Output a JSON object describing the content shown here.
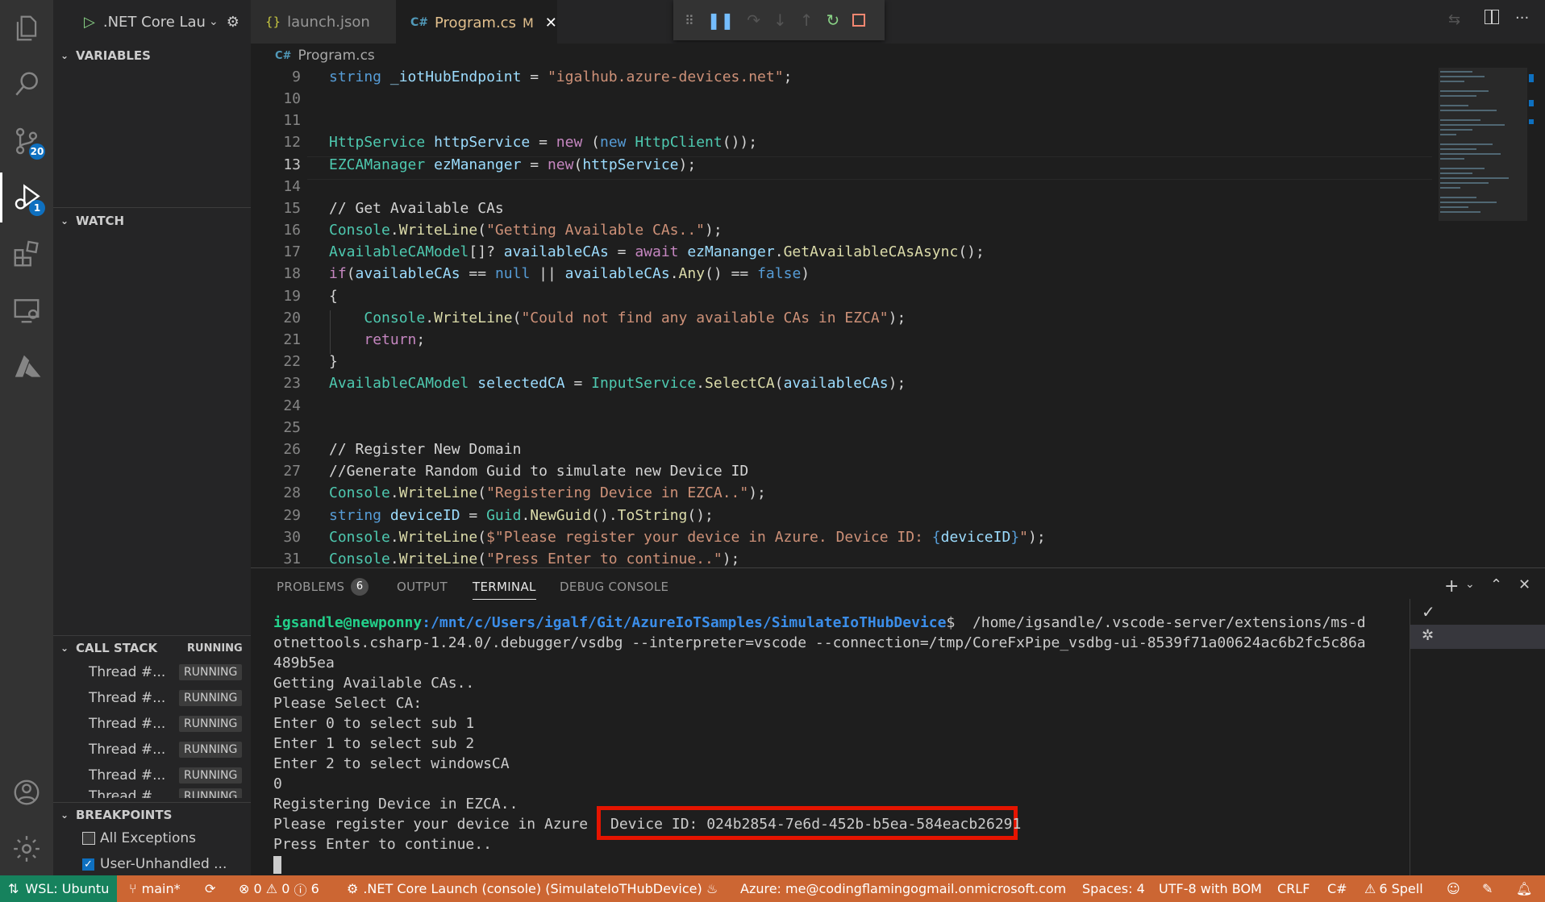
{
  "activity": {
    "scm_badge": "20",
    "debug_badge": "1"
  },
  "debug_toolbar": {
    "config_label": ".NET Core Lau"
  },
  "sidebar": {
    "variables_title": "VARIABLES",
    "watch_title": "WATCH",
    "call_stack_title": "CALL STACK",
    "call_stack_status": "RUNNING",
    "threads": [
      {
        "name": "Thread #...",
        "status": "RUNNING"
      },
      {
        "name": "Thread #...",
        "status": "RUNNING"
      },
      {
        "name": "Thread #...",
        "status": "RUNNING"
      },
      {
        "name": "Thread #...",
        "status": "RUNNING"
      },
      {
        "name": "Thread #...",
        "status": "RUNNING"
      },
      {
        "name": "Thread #...",
        "status": "RUNNING"
      }
    ],
    "breakpoints_title": "BREAKPOINTS",
    "breakpoints": [
      {
        "label": "All Exceptions",
        "checked": false
      },
      {
        "label": "User-Unhandled ...",
        "checked": true
      }
    ]
  },
  "tabs": [
    {
      "label": "launch.json",
      "icon": "{}"
    },
    {
      "label": "Program.cs",
      "modified": "M",
      "icon": "C#"
    }
  ],
  "breadcrumb": "Program.cs",
  "code": {
    "lines": [
      {
        "n": "9",
        "t": "string _iotHubEndpoint = \"igalhub.azure-devices.net\";"
      },
      {
        "n": "10",
        "t": ""
      },
      {
        "n": "11",
        "t": ""
      },
      {
        "n": "12",
        "t": "HttpService httpService = new (new HttpClient());"
      },
      {
        "n": "13",
        "t": "EZCAManager ezManager = new(httpService);"
      },
      {
        "n": "14",
        "t": ""
      },
      {
        "n": "15",
        "t": "// Get Available CAs"
      },
      {
        "n": "16",
        "t": "Console.WriteLine(\"Getting Available CAs..\");"
      },
      {
        "n": "17",
        "t": "AvailableCAModel[]? availableCAs = await ezManager.GetAvailableCAsAsync();"
      },
      {
        "n": "18",
        "t": "if(availableCAs == null || availableCAs.Any() == false)"
      },
      {
        "n": "19",
        "t": "{"
      },
      {
        "n": "20",
        "t": "    Console.WriteLine(\"Could not find any available CAs in EZCA\");"
      },
      {
        "n": "21",
        "t": "    return;"
      },
      {
        "n": "22",
        "t": "}"
      },
      {
        "n": "23",
        "t": "AvailableCAModel selectedCA = InputService.SelectCA(availableCAs);"
      },
      {
        "n": "24",
        "t": ""
      },
      {
        "n": "25",
        "t": ""
      },
      {
        "n": "26",
        "t": "// Register New Domain"
      },
      {
        "n": "27",
        "t": "//Generate Random Guid to simulate new Device ID"
      },
      {
        "n": "28",
        "t": "Console.WriteLine(\"Registering Device in EZCA..\");"
      },
      {
        "n": "29",
        "t": "string deviceID = Guid.NewGuid().ToString();"
      },
      {
        "n": "30",
        "t": "Console.WriteLine($\"Please register your device in Azure. Device ID: {deviceID}\");"
      },
      {
        "n": "31",
        "t": "Console.WriteLine(\"Press Enter to continue..\");"
      }
    ]
  },
  "panel": {
    "tabs": [
      "PROBLEMS",
      "OUTPUT",
      "TERMINAL",
      "DEBUG CONSOLE"
    ],
    "problems_count": "6",
    "active_tab": "TERMINAL"
  },
  "terminal": {
    "prompt_user": "igsandle@newponny",
    "prompt_path": ":/mnt/c/Users/igalf/Git/AzureIoTSamples/SimulateIoTHubDevice",
    "prompt_cmd_1": "$  /home/igsandle/.vscode-server/extensions/ms-d",
    "cmd_2": "otnettools.csharp-1.24.0/.debugger/vsdbg --interpreter=vscode --connection=/tmp/CoreFxPipe_vsdbg-ui-8539f71a00624ac6b2fc5c86a",
    "cmd_3": "489b5ea",
    "lines": [
      "Getting Available CAs..",
      "Please Select CA:",
      "Enter 0 to select sub 1",
      "Enter 1 to select sub 2",
      "Enter 2 to select windowsCA",
      "0",
      "Registering Device in EZCA.."
    ],
    "register_prefix": "Please register your device in Azure",
    "device_id_text": "Device ID: 024b2854-7e6d-452b-b5ea-584eacb26291",
    "press_enter": "Press Enter to continue.."
  },
  "statusbar": {
    "remote": "WSL: Ubuntu",
    "branch": "main*",
    "errors": "0",
    "warnings": "0",
    "infos": "6",
    "launch": ".NET Core Launch (console) (SimulateIoTHubDevice)",
    "azure": "Azure: me@codingflamingogmail.onmicrosoft.com",
    "spaces": "Spaces: 4",
    "encoding": "UTF-8 with BOM",
    "eol": "CRLF",
    "language": "C#",
    "spell": "6 Spell"
  },
  "colors": {
    "statusbar": "#cc6633",
    "accent": "#0e70c0",
    "highlight_box": "#e51400"
  }
}
